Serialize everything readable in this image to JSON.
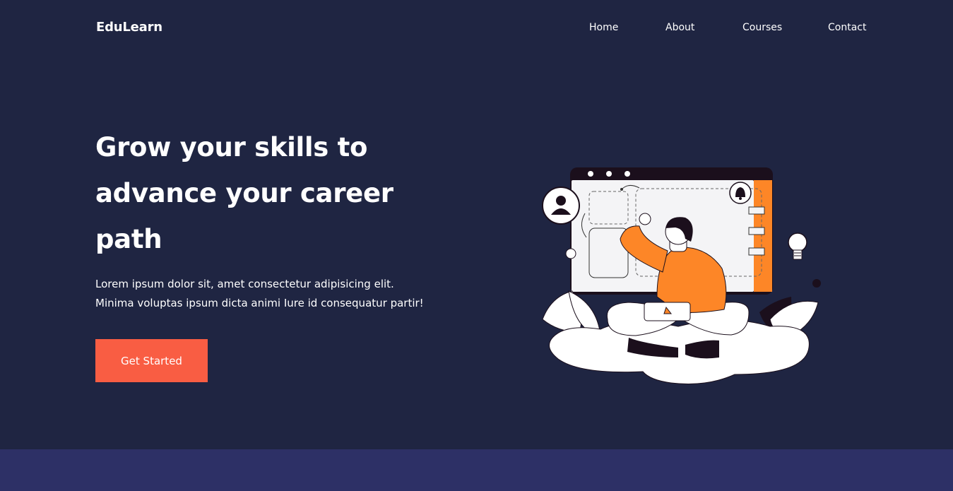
{
  "brand": {
    "name": "EduLearn"
  },
  "nav": {
    "items": [
      {
        "label": "Home"
      },
      {
        "label": "About"
      },
      {
        "label": "Courses"
      },
      {
        "label": "Contact"
      }
    ]
  },
  "hero": {
    "title": "Grow your skills to advance your career path",
    "description_lines": [
      "Lorem ipsum dolor sit, amet consectetur adipisicing elit.",
      "Minima voluptas ipsum dicta animi Iure id consequatur partir!"
    ],
    "cta_label": "Get Started"
  },
  "colors": {
    "background": "#1f2542",
    "accent": "#f95d43",
    "illustration_orange": "#fd8627",
    "bottom_band": "#2d3066"
  },
  "icons": [
    "user-icon",
    "bell-icon",
    "lightbulb-icon",
    "laptop-icon"
  ]
}
